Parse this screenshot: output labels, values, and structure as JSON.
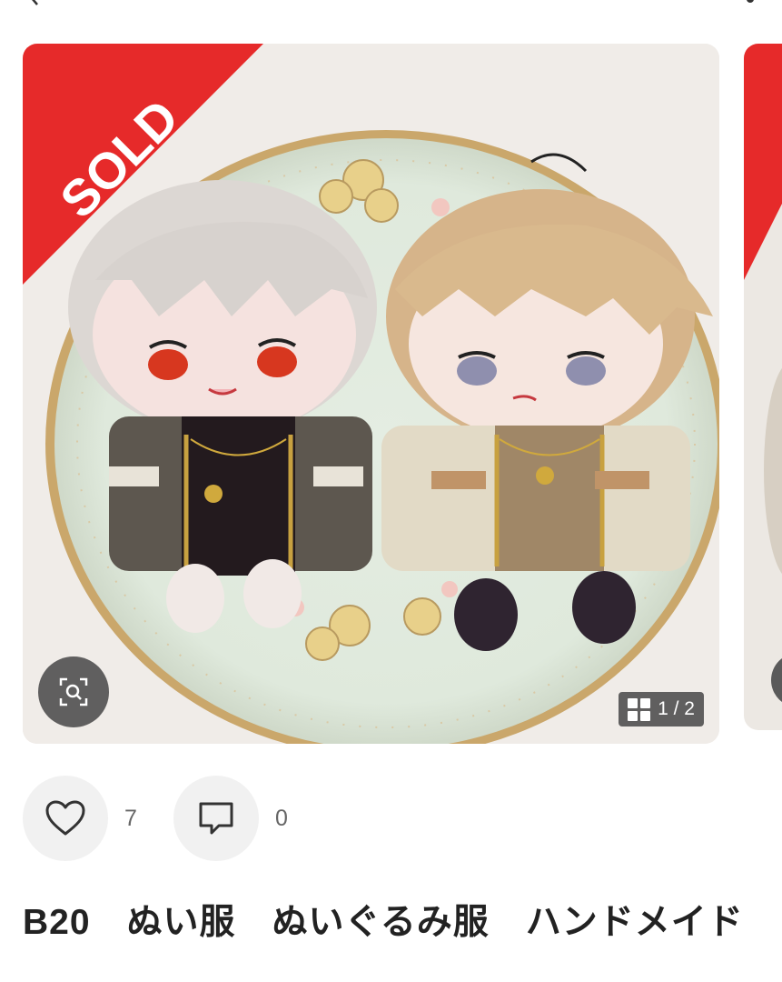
{
  "icons": {
    "back": "chevron-left-icon",
    "more": "more-vertical-icon",
    "zoom": "image-search-icon",
    "gallery": "grid-icon",
    "like": "heart-icon",
    "comment": "comment-icon"
  },
  "colors": {
    "sold_ribbon": "#e62a2a",
    "overlay": "#464646",
    "accent_text": "#222222"
  },
  "listing": {
    "status_badge": "SOLD",
    "image_counter": "1 / 2",
    "likes_count": "7",
    "comments_count": "0",
    "title": "B20　ぬい服　ぬいぐるみ服　ハンドメイド"
  }
}
